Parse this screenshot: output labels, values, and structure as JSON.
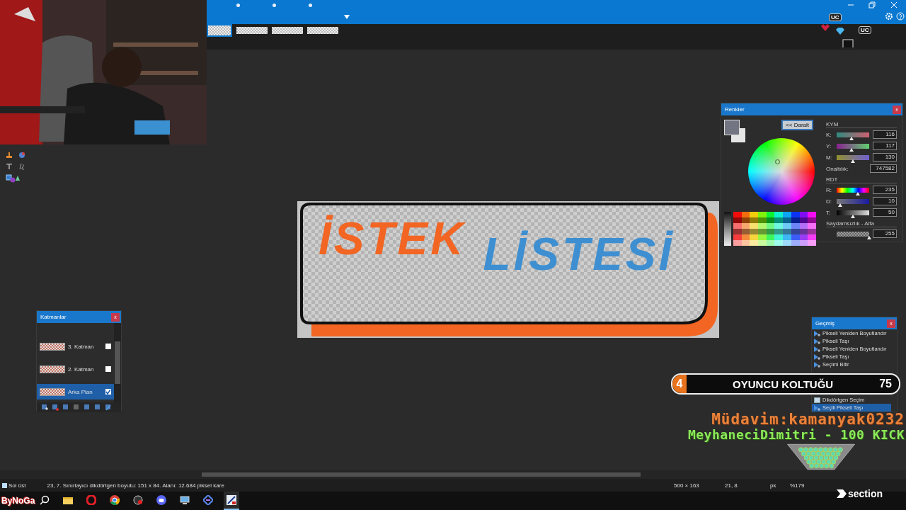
{
  "image_tabs": [
    {
      "selected": true
    },
    {
      "selected": false
    },
    {
      "selected": false
    },
    {
      "selected": false
    }
  ],
  "canvas": {
    "texts": [
      {
        "text": "İSTEK",
        "color": "#f26522"
      },
      {
        "text": "LİSTESİ",
        "color": "#3d8fd1"
      }
    ]
  },
  "colors_panel": {
    "title": "Renkler",
    "close_button": "x",
    "collapse_button": "<< Daralt",
    "rgb_heading": "KYM",
    "rgb": [
      {
        "label": "K:",
        "value": "116",
        "level": 0.455
      },
      {
        "label": "Y:",
        "value": "117",
        "level": 0.459
      },
      {
        "label": "M:",
        "value": "130",
        "level": 0.51
      }
    ],
    "hex_label": "Onaltılık:",
    "hex": "747582",
    "hsv_heading": "RDT",
    "hsv": [
      {
        "label": "R:",
        "value": "235",
        "level": 0.653
      },
      {
        "label": "D:",
        "value": "10",
        "level": 0.1
      },
      {
        "label": "T:",
        "value": "50",
        "level": 0.5
      }
    ],
    "alpha_heading": "Saydamsızlık - Alfa",
    "alpha": {
      "value": "255",
      "level": 1
    }
  },
  "layers_panel": {
    "title": "Katmanlar",
    "close_button": "x",
    "layers": [
      {
        "name": "3. Katman",
        "visible": false,
        "selected": false
      },
      {
        "name": "2. Katman",
        "visible": false,
        "selected": false
      },
      {
        "name": "Arka Plan",
        "visible": true,
        "selected": true
      }
    ]
  },
  "history_panel": {
    "title": "Geçmiş",
    "close_button": "x",
    "items": [
      {
        "label": "Pikseli Yeniden Boyutlandır",
        "kind": "pixel_op",
        "selected": false
      },
      {
        "label": "Pikseli Taşı",
        "kind": "pixel_op",
        "selected": false
      },
      {
        "label": "Pikseli Yeniden Boyutlandır",
        "kind": "pixel_op",
        "selected": false
      },
      {
        "label": "Pikseli Taşı",
        "kind": "pixel_op",
        "selected": false
      },
      {
        "label": "Seçimi Bitir",
        "kind": "pixel_op",
        "selected": false
      },
      {
        "label": "Dikdörtgen Seçim",
        "kind": "rect_select",
        "selected": false
      },
      {
        "label": "Seçili Pikseli Taşı",
        "kind": "pixel_op",
        "selected": true
      }
    ]
  },
  "status_bar": {
    "left": [
      "Sol üst",
      "23, 7. Sınırlayıcı dikdörtgen boyutu: 151 x 84. Alanı: 12.684 piksel kare"
    ],
    "image_size": "500 × 163",
    "cursor": "21, 8",
    "unit": "pk",
    "zoom": "%179"
  },
  "stream_overlay": {
    "seat_rank": "4",
    "seat_title": "OYUNCU KOLTUĞU",
    "seat_count": "75",
    "regular": "Müdavim:kamanyak0232",
    "kick_message": "MeyhaneciDimitri - 100 KICK",
    "logo": "ByNoGa",
    "brand": "section",
    "badges": [
      "UC",
      "UC"
    ]
  }
}
